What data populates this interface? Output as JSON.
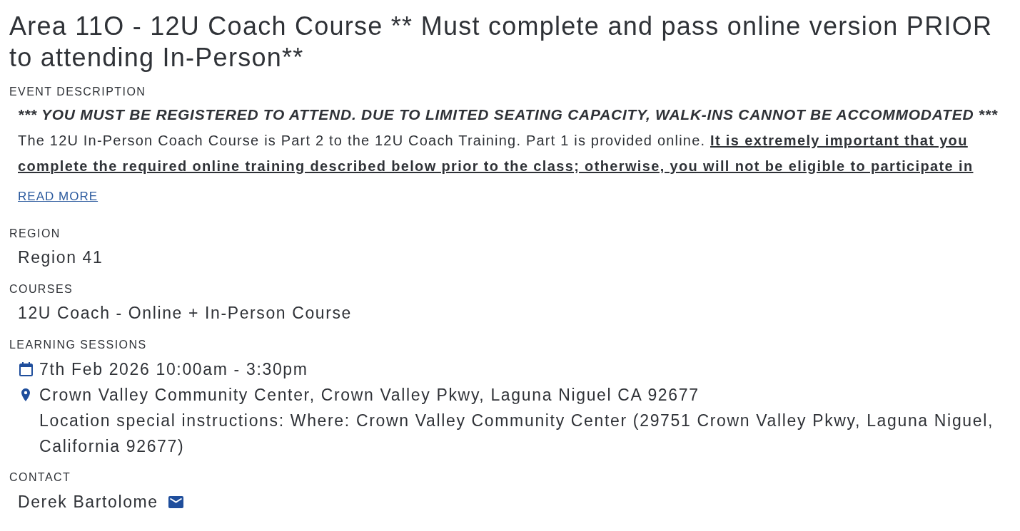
{
  "title": "Area 11O - 12U Coach Course ** Must complete and pass online version PRIOR to attending In-Person**",
  "sections": [
    {
      "kind": "description",
      "label": "EVENT DESCRIPTION",
      "notice": "*** YOU MUST BE REGISTERED TO ATTEND. DUE TO LIMITED SEATING CAPACITY, WALK-INS CANNOT BE ACCOMMODATED ***",
      "body": "The 12U In-Person Coach Course is Part 2 to the 12U Coach Training. Part 1 is provided online. **It is extremely important that you complete the required online training described below prior to the class; otherwise, you will not be eligible to participate in**",
      "link": "READ MORE"
    },
    {
      "kind": "text",
      "label": "REGION",
      "value": "Region 41"
    },
    {
      "kind": "text",
      "label": "COURSES",
      "value": "12U Coach - Online + In-Person Course"
    },
    {
      "kind": "sessions",
      "label": "LEARNING SESSIONS",
      "sessions": [
        {
          "date": "7th Feb 2026 10:00am - 3:30pm",
          "location": "Crown Valley Community Center, Crown Valley Pkwy, Laguna Niguel CA 92677",
          "instructions": "Location special instructions: Where: Crown Valley Community Center (29751 Crown Valley Pkwy, Laguna Niguel, California 92677)"
        }
      ]
    },
    {
      "kind": "contact",
      "label": "CONTACT",
      "name": "Derek Bartolome"
    }
  ]
}
